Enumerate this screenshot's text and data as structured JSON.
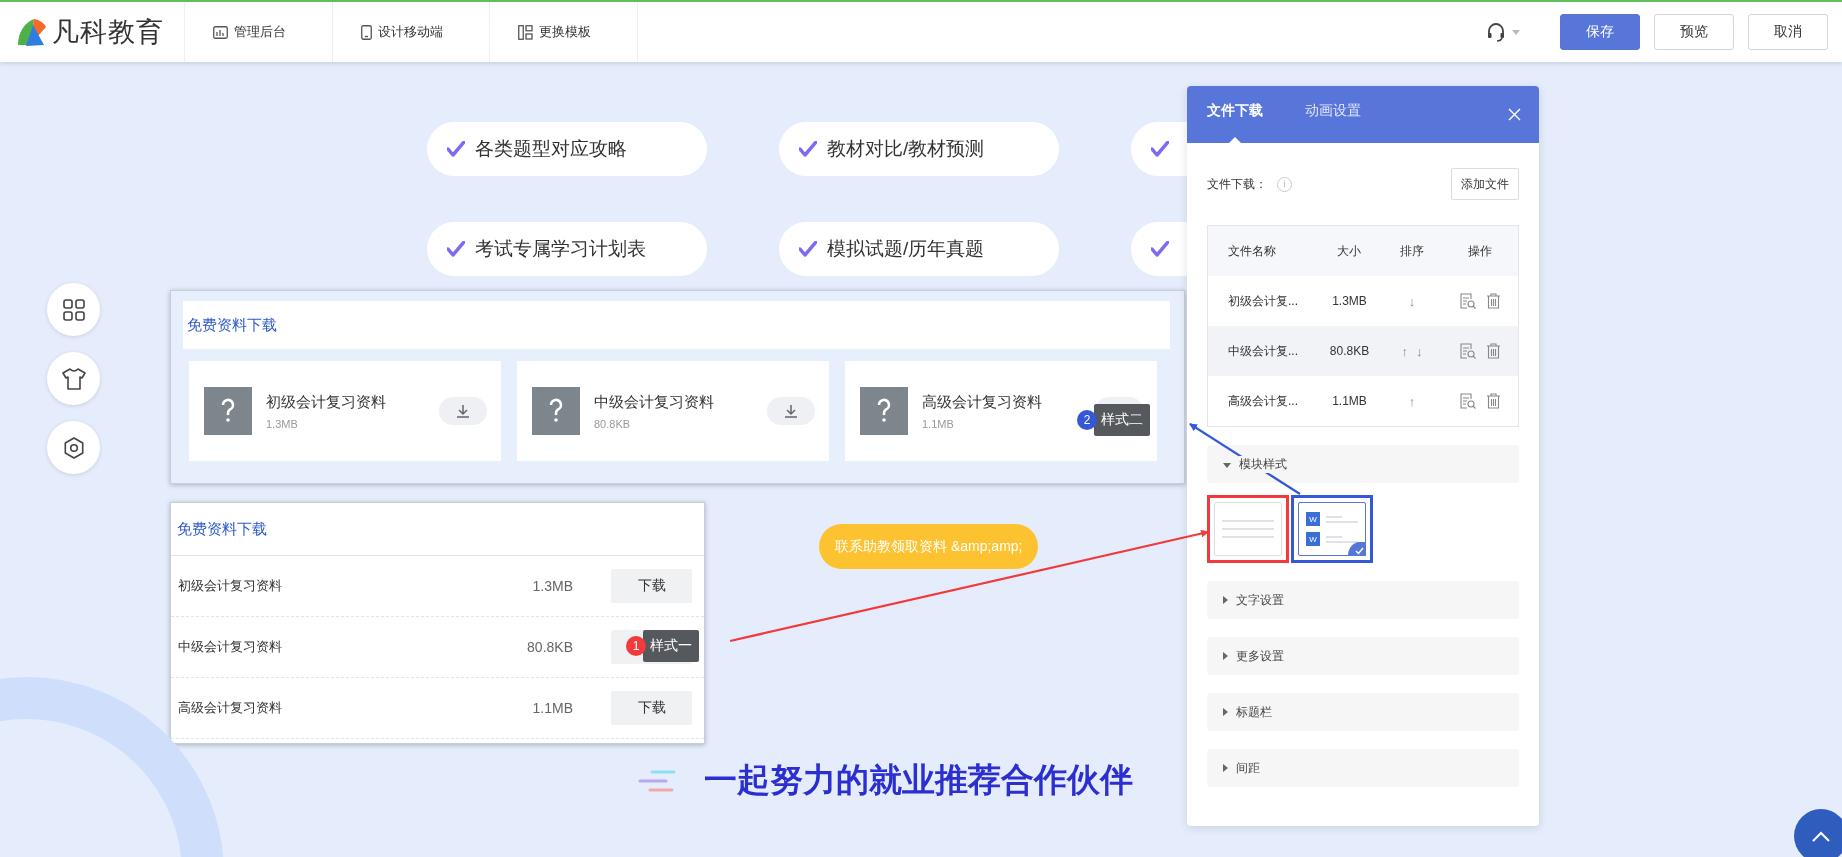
{
  "header": {
    "logo_text": "凡科教育",
    "nav": [
      {
        "label": "管理后台"
      },
      {
        "label": "设计移动端"
      },
      {
        "label": "更换模板"
      }
    ],
    "buttons": [
      {
        "label": "保存",
        "kind": "primary"
      },
      {
        "label": "预览",
        "kind": "default"
      },
      {
        "label": "取消",
        "kind": "default"
      }
    ]
  },
  "features": [
    {
      "kind": "text",
      "label": "各类题型对应攻略"
    },
    {
      "kind": "text",
      "label": "教材对比/教材预测"
    },
    {
      "kind": "icon_only"
    },
    {
      "kind": "text",
      "label": "考试专属学习计划表"
    },
    {
      "kind": "text",
      "label": "模拟试题/历年真题"
    },
    {
      "kind": "icon_only"
    }
  ],
  "style_two_module": {
    "title": "免费资料下载",
    "files": [
      {
        "name": "初级会计复习资料",
        "size": "1.3MB"
      },
      {
        "name": "中级会计复习资料",
        "size": "80.8KB"
      },
      {
        "name": "高级会计复习资料",
        "size": "1.1MB"
      }
    ]
  },
  "style_one_module": {
    "title": "免费资料下载",
    "files": [
      {
        "name": "初级会计复习资料",
        "size": "1.3MB",
        "button": "下载"
      },
      {
        "name": "中级会计复习资料",
        "size": "80.8KB"
      },
      {
        "name": "高级会计复习资料",
        "size": "1.1MB",
        "button": "下载"
      }
    ]
  },
  "contact_pill": "联系助教领取资料 &amp;amp;",
  "partners_heading": "一起努力的就业推荐合作伙伴",
  "panel": {
    "tabs": [
      {
        "label": "文件下载",
        "selected": true
      },
      {
        "label": "动画设置",
        "selected": false
      }
    ],
    "files_label": "文件下载：",
    "info": "i",
    "add_button": "添加文件",
    "table": {
      "columns": [
        "文件名称",
        "大小",
        "排序",
        "操作"
      ],
      "rows": [
        {
          "name": "初级会计复...",
          "size": "1.3MB",
          "sort": [
            "↓"
          ],
          "highlighted": false
        },
        {
          "name": "中级会计复...",
          "size": "80.8KB",
          "sort": [
            "↑",
            "↓"
          ],
          "highlighted": true
        },
        {
          "name": "高级会计复...",
          "size": "1.1MB",
          "sort": [
            "↑"
          ],
          "highlighted": false
        }
      ]
    },
    "style_section": {
      "label": "模块样式",
      "expanded": true
    },
    "styles": [
      {
        "kind": "list",
        "selected": false
      },
      {
        "kind": "cards",
        "selected": true,
        "file_badges": [
          "W",
          "W"
        ]
      }
    ],
    "sections": [
      {
        "label": "文字设置",
        "expanded": false
      },
      {
        "label": "更多设置",
        "expanded": false
      },
      {
        "label": "标题栏",
        "expanded": false
      },
      {
        "label": "间距",
        "expanded": false
      }
    ]
  },
  "annotations": [
    {
      "number": "1",
      "label": "样式一",
      "color": "#f23a3c"
    },
    {
      "number": "2",
      "label": "样式二",
      "color": "#3558d6"
    }
  ]
}
